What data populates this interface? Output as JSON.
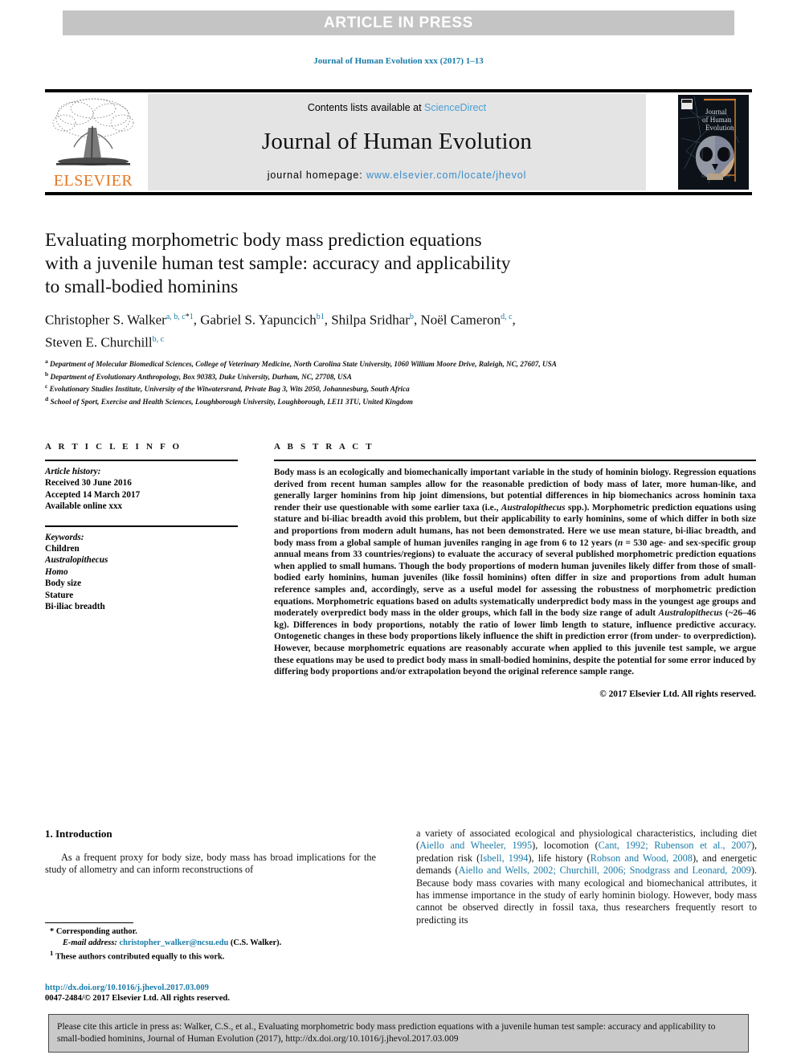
{
  "banner": {
    "text": "ARTICLE IN PRESS"
  },
  "journal_line": "Journal of Human Evolution xxx (2017) 1–13",
  "masthead": {
    "contents_prefix": "Contents lists available at ",
    "contents_link": "ScienceDirect",
    "journal_title": "Journal of Human Evolution",
    "homepage_prefix": "journal homepage: ",
    "homepage_link": "www.elsevier.com/locate/jhevol",
    "publisher": "ELSEVIER",
    "cover_title_line1": "Journal",
    "cover_title_line2": "of Human",
    "cover_title_line3": "Evolution"
  },
  "article": {
    "title_line1": "Evaluating morphometric body mass prediction equations",
    "title_line2": "with a juvenile human test sample: accuracy and applicability",
    "title_line3": "to small-bodied hominins",
    "authors": [
      {
        "name": "Christopher S. Walker",
        "marks": "a, b, c",
        "star": "*",
        "note": "1",
        "sep": ", "
      },
      {
        "name": "Gabriel S. Yapuncich",
        "marks": "b",
        "star": "",
        "note": "1",
        "sep": ", "
      },
      {
        "name": "Shilpa Sridhar",
        "marks": "b",
        "star": "",
        "note": "",
        "sep": ", "
      },
      {
        "name": "Noël Cameron",
        "marks": "d, c",
        "star": "",
        "note": "",
        "sep": ", "
      },
      {
        "name": "Steven E. Churchill",
        "marks": "b, c",
        "star": "",
        "note": "",
        "sep": ""
      }
    ],
    "affiliations": [
      {
        "mark": "a",
        "text": "Department of Molecular Biomedical Sciences, College of Veterinary Medicine, North Carolina State University, 1060 William Moore Drive, Raleigh, NC, 27607, USA"
      },
      {
        "mark": "b",
        "text": "Department of Evolutionary Anthropology, Box 90383, Duke University, Durham, NC, 27708, USA"
      },
      {
        "mark": "c",
        "text": "Evolutionary Studies Institute, University of the Witwatersrand, Private Bag 3, Wits 2050, Johannesburg, South Africa"
      },
      {
        "mark": "d",
        "text": "School of Sport, Exercise and Health Sciences, Loughborough University, Loughborough, LE11 3TU, United Kingdom"
      }
    ]
  },
  "article_info": {
    "heading": "A R T I C L E   I N F O",
    "history_label": "Article history:",
    "received": "Received 30 June 2016",
    "accepted": "Accepted 14 March 2017",
    "available": "Available online xxx",
    "keywords_label": "Keywords:",
    "keywords": [
      "Children",
      "Australopithecus",
      "Homo",
      "Body size",
      "Stature",
      "Bi-iliac breadth"
    ]
  },
  "abstract": {
    "heading": "A B S T R A C T",
    "p1": "Body mass is an ecologically and biomechanically important variable in the study of hominin biology. Regression equations derived from recent human samples allow for the reasonable prediction of body mass of later, more human-like, and generally larger hominins from hip joint dimensions, but potential differences in hip biomechanics across hominin taxa render their use questionable with some earlier taxa (i.e., ",
    "italic1": "Australopithecus",
    "p2": " spp.). Morphometric prediction equations using stature and bi-iliac breadth avoid this problem, but their applicability to early hominins, some of which differ in both size and proportions from modern adult humans, has not been demonstrated. Here we use mean stature, bi-iliac breadth, and body mass from a global sample of human juveniles ranging in age from 6 to 12 years (",
    "italic2": "n",
    "p3": " = 530 age- and sex-specific group annual means from 33 countries/regions) to evaluate the accuracy of several published morphometric prediction equations when applied to small humans. Though the body proportions of modern human juveniles likely differ from those of small-bodied early hominins, human juveniles (like fossil hominins) often differ in size and proportions from adult human reference samples and, accordingly, serve as a useful model for assessing the robustness of morphometric prediction equations. Morphometric equations based on adults systematically underpredict body mass in the youngest age groups and moderately overpredict body mass in the older groups, which fall in the body size range of adult ",
    "italic3": "Australopithecus",
    "p4": " (~26–46 kg). Differences in body proportions, notably the ratio of lower limb length to stature, influence predictive accuracy. Ontogenetic changes in these body proportions likely influence the shift in prediction error (from under- to overprediction). However, because morphometric equations are reasonably accurate when applied to this juvenile test sample, we argue these equations may be used to predict body mass in small-bodied hominins, despite the potential for some error induced by differing body proportions and/or extrapolation beyond the original reference sample range.",
    "copyright": "© 2017 Elsevier Ltd. All rights reserved."
  },
  "introduction": {
    "heading": "1. Introduction",
    "left_para": "As a frequent proxy for body size, body mass has broad implications for the study of allometry and can inform reconstructions of",
    "right_parts": [
      {
        "type": "text",
        "text": "a variety of associated ecological and physiological characteristics, including diet ("
      },
      {
        "type": "cite",
        "text": "Aiello and Wheeler, 1995"
      },
      {
        "type": "text",
        "text": "), locomotion ("
      },
      {
        "type": "cite",
        "text": "Cant, 1992; Rubenson et al., 2007"
      },
      {
        "type": "text",
        "text": "), predation risk ("
      },
      {
        "type": "cite",
        "text": "Isbell, 1994"
      },
      {
        "type": "text",
        "text": "), life history ("
      },
      {
        "type": "cite",
        "text": "Robson and Wood, 2008"
      },
      {
        "type": "text",
        "text": "), and energetic demands ("
      },
      {
        "type": "cite",
        "text": "Aiello and Wells, 2002; Churchill, 2006; Snodgrass and Leonard, 2009"
      },
      {
        "type": "text",
        "text": "). Because body mass covaries with many ecological and biomechanical attributes, it has immense importance in the study of early hominin biology. However, body mass cannot be observed directly in fossil taxa, thus researchers frequently resort to predicting its"
      }
    ]
  },
  "footnotes": {
    "corresponding": "Corresponding author.",
    "email_label": "E-mail address:",
    "email": "christopher_walker@ncsu.edu",
    "email_suffix": "(C.S. Walker).",
    "equal_contrib": "These authors contributed equally to this work.",
    "doi": "http://dx.doi.org/10.1016/j.jhevol.2017.03.009",
    "issn_line": "0047-2484/© 2017 Elsevier Ltd. All rights reserved."
  },
  "citation_footer": {
    "text": "Please cite this article in press as: Walker, C.S., et al., Evaluating morphometric body mass prediction equations with a juvenile human test sample: accuracy and applicability to small-bodied hominins, Journal of Human Evolution (2017), http://dx.doi.org/10.1016/j.jhevol.2017.03.009"
  },
  "colors": {
    "link": "#1a7ba8",
    "elsevier_orange": "#e87722",
    "banner_gray": "#c4c4c4",
    "masthead_gray": "#e4e4e4",
    "footer_gray": "#c9c9c9"
  }
}
